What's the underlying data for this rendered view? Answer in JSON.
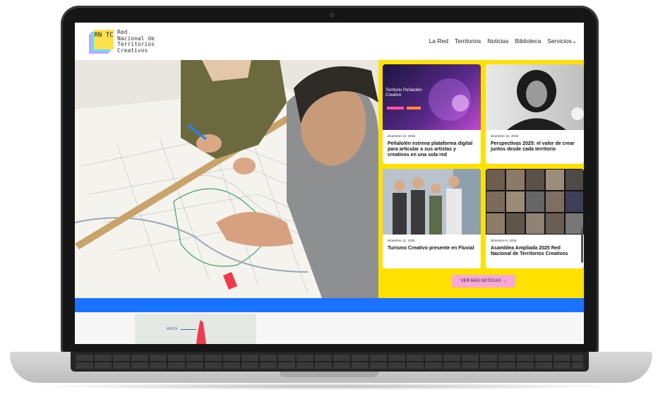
{
  "site": {
    "logo_mark": "RN TC",
    "logo_text": [
      "Red",
      "Nacional de",
      "Territorios",
      "Creativos"
    ]
  },
  "nav": {
    "items": [
      "La Red",
      "Territorios",
      "Noticias",
      "Biblioteca",
      "Servicios"
    ],
    "dropdown_glyph": "⌄"
  },
  "news": {
    "cards": [
      {
        "date": "diciembre 22, 2025",
        "title": "Peñalolén estrena plataforma digital para articular a sus artistas y creativos en una sola red",
        "image_text": "Territorio Peñalolén Creativo"
      },
      {
        "date": "diciembre 22, 2025",
        "title": "Perspectivas 2025: el valor de crear juntos desde cada territorio"
      },
      {
        "date": "diciembre 11, 2025",
        "title": "Turismo Creativo presente en Fluvial"
      },
      {
        "date": "diciembre 8, 2025",
        "title": "Asamblea Ampliada 2025 Red Nacional de Territorios Creativos"
      }
    ],
    "more_button": "VER MÁS NOTICIAS →"
  },
  "map": {
    "label": "ARICA"
  },
  "colors": {
    "news_bg": "#ffe100",
    "band": "#1a73ff",
    "button": "#f7a8d8"
  }
}
